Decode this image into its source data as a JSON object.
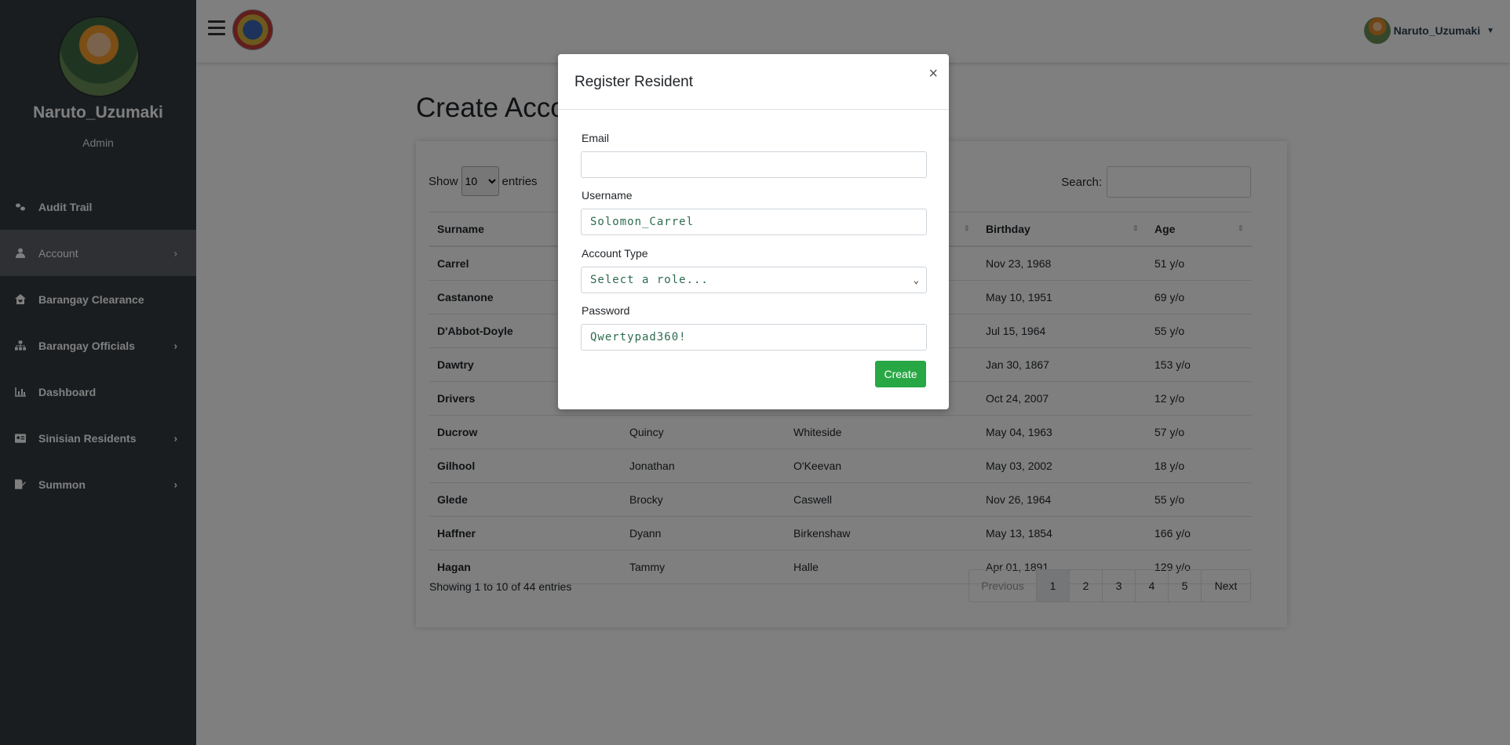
{
  "sidebar": {
    "user_name": "Naruto_Uzumaki",
    "user_role": "Admin",
    "items": [
      {
        "label": "Audit Trail",
        "icon": "footprints-icon",
        "active": false,
        "has_submenu": false
      },
      {
        "label": "Account",
        "icon": "user-icon",
        "active": true,
        "has_submenu": true
      },
      {
        "label": "Barangay Clearance",
        "icon": "house-heart-icon",
        "active": false,
        "has_submenu": false
      },
      {
        "label": "Barangay Officials",
        "icon": "sitemap-icon",
        "active": false,
        "has_submenu": true
      },
      {
        "label": "Dashboard",
        "icon": "chart-bar-icon",
        "active": false,
        "has_submenu": false
      },
      {
        "label": "Sinisian Residents",
        "icon": "id-card-icon",
        "active": false,
        "has_submenu": true
      },
      {
        "label": "Summon",
        "icon": "file-signature-icon",
        "active": false,
        "has_submenu": true
      }
    ]
  },
  "header": {
    "user_name": "Naruto_Uzumaki"
  },
  "main": {
    "title": "Create Account",
    "show_label": "Show",
    "entries_label": "entries",
    "page_size": "10",
    "search_label": "Search:",
    "columns": [
      "Surname",
      "",
      "",
      "Birthday",
      "Age"
    ],
    "rows": [
      [
        "Carrel",
        "",
        "",
        "Nov 23, 1968",
        "51 y/o"
      ],
      [
        "Castanone",
        "",
        "",
        "May 10, 1951",
        "69 y/o"
      ],
      [
        "D'Abbot-Doyle",
        "",
        "",
        "Jul 15, 1964",
        "55 y/o"
      ],
      [
        "Dawtry",
        "",
        "",
        "Jan 30, 1867",
        "153 y/o"
      ],
      [
        "Drivers",
        "",
        "",
        "Oct 24, 2007",
        "12 y/o"
      ],
      [
        "Ducrow",
        "Quincy",
        "Whiteside",
        "May 04, 1963",
        "57 y/o"
      ],
      [
        "Gilhool",
        "Jonathan",
        "O'Keevan",
        "May 03, 2002",
        "18 y/o"
      ],
      [
        "Glede",
        "Brocky",
        "Caswell",
        "Nov 26, 1964",
        "55 y/o"
      ],
      [
        "Haffner",
        "Dyann",
        "Birkenshaw",
        "May 13, 1854",
        "166 y/o"
      ],
      [
        "Hagan",
        "Tammy",
        "Halle",
        "Apr 01, 1891",
        "129 y/o"
      ]
    ],
    "info": "Showing 1 to 10 of 44 entries",
    "pagination": {
      "previous": "Previous",
      "pages": [
        "1",
        "2",
        "3",
        "4",
        "5"
      ],
      "current": "1",
      "next": "Next"
    }
  },
  "modal": {
    "title": "Register Resident",
    "close": "×",
    "email_label": "Email",
    "email_value": "",
    "username_label": "Username",
    "username_value": "Solomon_Carrel",
    "account_type_label": "Account Type",
    "account_type_value": "Select a role...",
    "password_label": "Password",
    "password_value": "Qwertypad360!",
    "create_label": "Create"
  },
  "colors": {
    "sidebar_bg": "#343a40",
    "sidebar_active": "#5d6166",
    "create_button": "#28a745",
    "input_text": "#2d6b4f"
  }
}
